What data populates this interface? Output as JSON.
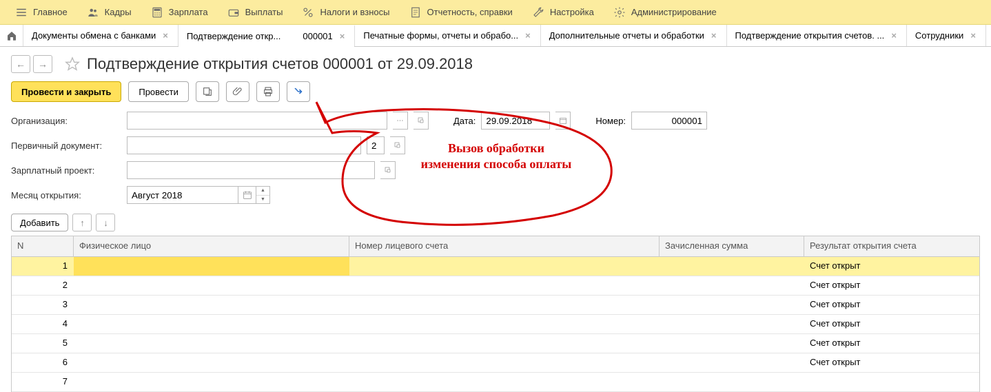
{
  "menu": [
    {
      "label": "Главное",
      "icon": "bars"
    },
    {
      "label": "Кадры",
      "icon": "people"
    },
    {
      "label": "Зарплата",
      "icon": "calc"
    },
    {
      "label": "Выплаты",
      "icon": "wallet"
    },
    {
      "label": "Налоги и взносы",
      "icon": "percent"
    },
    {
      "label": "Отчетность, справки",
      "icon": "report"
    },
    {
      "label": "Настройка",
      "icon": "wrench"
    },
    {
      "label": "Администрирование",
      "icon": "gear"
    }
  ],
  "tabs": [
    {
      "label": "Документы обмена с банками",
      "active": false
    },
    {
      "label": "Подтверждение откр...",
      "num": "000001",
      "active": true
    },
    {
      "label": "Печатные формы, отчеты и обрабо...",
      "active": false
    },
    {
      "label": "Дополнительные отчеты и обработки",
      "active": false
    },
    {
      "label": "Подтверждение открытия счетов. ...",
      "active": false
    },
    {
      "label": "Сотрудники",
      "active": false
    }
  ],
  "page": {
    "title": "Подтверждение открытия счетов         000001 от 29.09.2018"
  },
  "toolbar": {
    "save_close": "Провести и закрыть",
    "post": "Провести"
  },
  "form": {
    "org_label": "Организация:",
    "org_value": "",
    "date_label": "Дата:",
    "date_value": "29.09.2018",
    "number_label": "Номер:",
    "number_value": "000001",
    "primary_doc_label": "Первичный документ:",
    "primary_doc_value": "",
    "primary_doc_aux": "2",
    "payroll_project_label": "Зарплатный проект:",
    "payroll_project_value": "",
    "month_label": "Месяц открытия:",
    "month_value": "Август 2018",
    "add_button": "Добавить"
  },
  "grid": {
    "headers": {
      "n": "N",
      "fiz": "Физическое лицо",
      "acc": "Номер лицевого счета",
      "sum": "Зачисленная сумма",
      "res": "Результат открытия счета"
    },
    "rows": [
      {
        "n": "1",
        "fiz": "",
        "acc": "",
        "sum": "",
        "res": "Счет открыт",
        "selected": true
      },
      {
        "n": "2",
        "fiz": "",
        "acc": "",
        "sum": "",
        "res": "Счет открыт",
        "selected": false
      },
      {
        "n": "3",
        "fiz": "",
        "acc": "",
        "sum": "",
        "res": "Счет открыт",
        "selected": false
      },
      {
        "n": "4",
        "fiz": "",
        "acc": "",
        "sum": "",
        "res": "Счет открыт",
        "selected": false
      },
      {
        "n": "5",
        "fiz": "",
        "acc": "",
        "sum": "",
        "res": "Счет открыт",
        "selected": false
      },
      {
        "n": "6",
        "fiz": "",
        "acc": "",
        "sum": "",
        "res": "Счет открыт",
        "selected": false
      },
      {
        "n": "7",
        "fiz": "",
        "acc": "",
        "sum": "",
        "res": "",
        "selected": false
      }
    ]
  },
  "callout": {
    "line1": "Вызов обработки",
    "line2": "изменения способа оплаты"
  }
}
